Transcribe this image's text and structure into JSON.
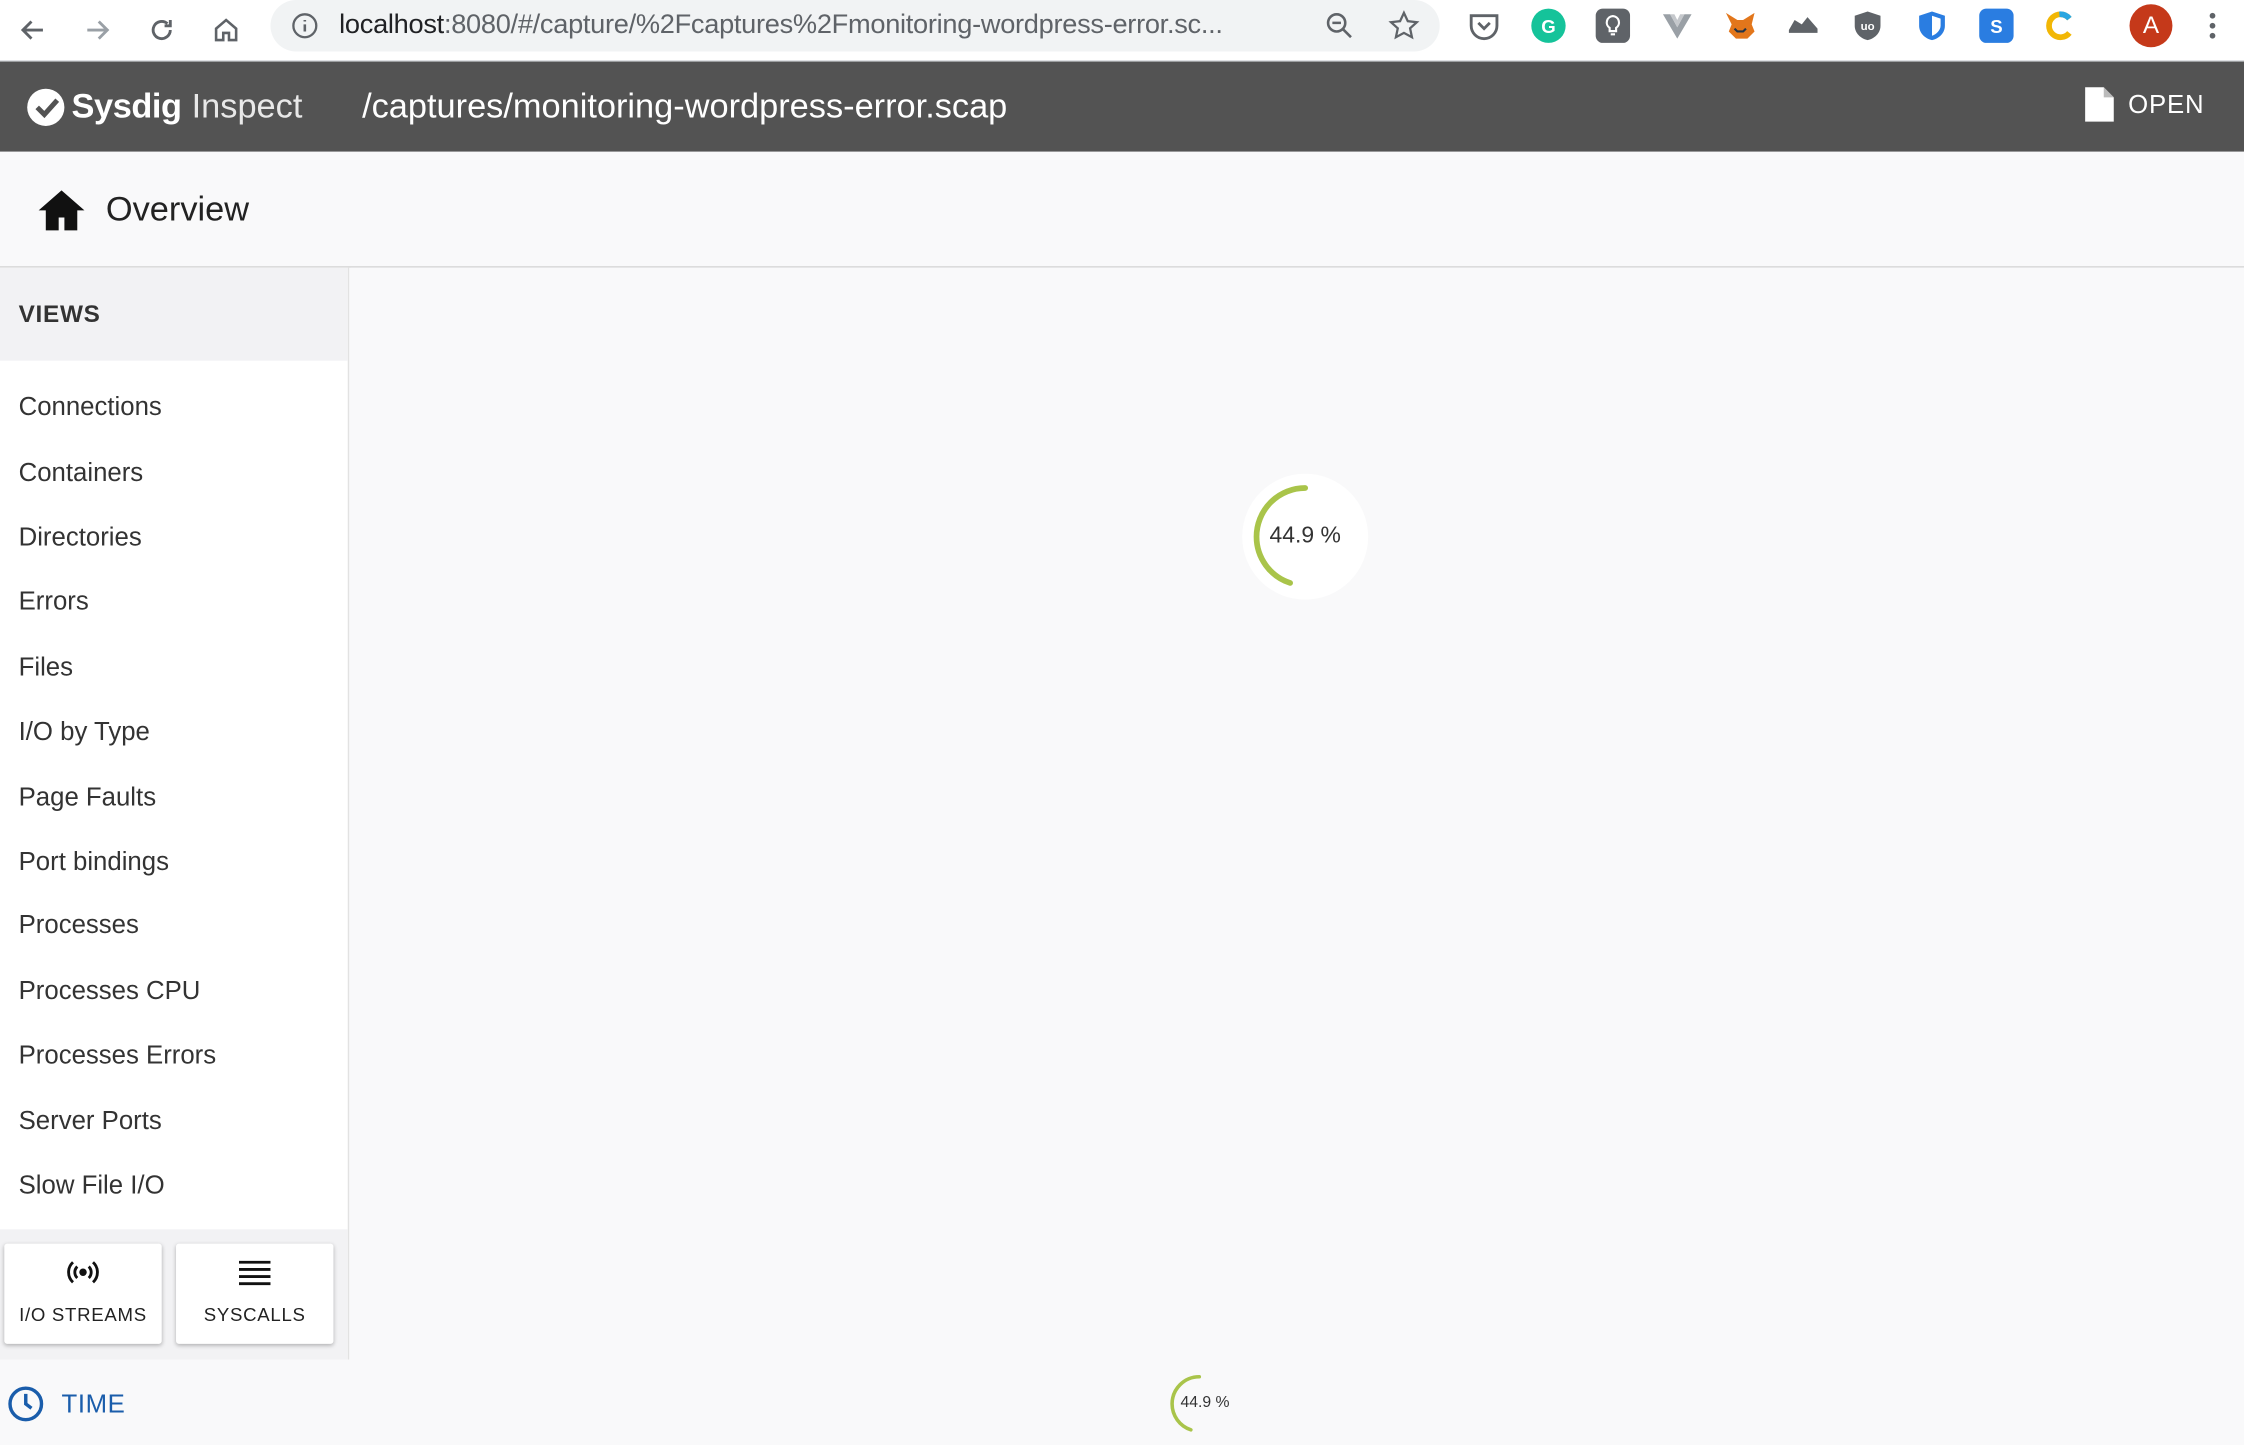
{
  "browser": {
    "url_host": "localhost",
    "url_path": ":8080/#/capture/%2Fcaptures%2Fmonitoring-wordpress-error.sc...",
    "profile_initial": "A"
  },
  "header": {
    "brand": "Sysdig",
    "product": "Inspect",
    "file_path": "/captures/monitoring-wordpress-error.scap",
    "open_label": "OPEN"
  },
  "overview": {
    "title": "Overview"
  },
  "sidebar": {
    "section_title": "VIEWS",
    "items": [
      {
        "label": "Connections"
      },
      {
        "label": "Containers"
      },
      {
        "label": "Directories"
      },
      {
        "label": "Errors"
      },
      {
        "label": "Files"
      },
      {
        "label": "I/O by Type"
      },
      {
        "label": "Page Faults"
      },
      {
        "label": "Port bindings"
      },
      {
        "label": "Processes"
      },
      {
        "label": "Processes CPU"
      },
      {
        "label": "Processes Errors"
      },
      {
        "label": "Server Ports"
      },
      {
        "label": "Slow File I/O"
      }
    ],
    "tools": [
      {
        "label": "I/O STREAMS",
        "icon": "broadcast-icon"
      },
      {
        "label": "SYSCALLS",
        "icon": "list-icon"
      }
    ]
  },
  "main": {
    "progress_label": "44.9 %",
    "progress_fraction": 0.449
  },
  "timeline": {
    "label": "TIME",
    "progress_label": "44.9 %",
    "progress_fraction": 0.449
  },
  "colors": {
    "header_bg": "#535353",
    "progress": "#a9c44a",
    "time_accent": "#1a5dab"
  }
}
